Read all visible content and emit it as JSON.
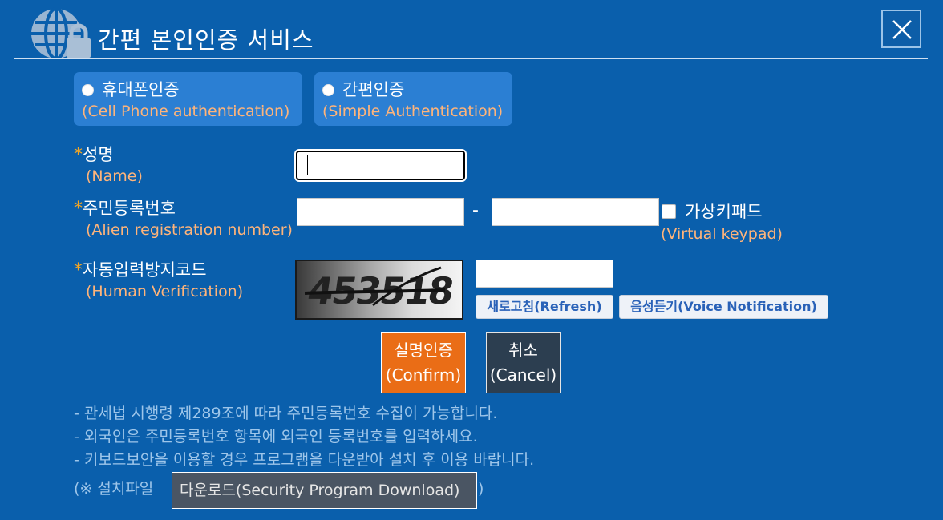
{
  "header": {
    "title": "간편 본인인증 서비스",
    "logo_icon": "globe-lock-icon",
    "close_icon": "close-icon"
  },
  "auth_options": [
    {
      "label": "휴대폰인증",
      "sub": "(Cell Phone authentication)",
      "selected": false
    },
    {
      "label": "간편인증",
      "sub": "(Simple Authentication)",
      "selected": false
    }
  ],
  "form": {
    "required_mark": "*",
    "name": {
      "label": "성명",
      "sub": "(Name)",
      "value": ""
    },
    "registration": {
      "label": "주민등록번호",
      "sub": "(Alien registration number)",
      "part1": "",
      "separator": "-",
      "part2": "",
      "virtual_keypad_label": "가상키패드",
      "virtual_keypad_sub": "(Virtual keypad)",
      "virtual_keypad_checked": false
    },
    "captcha": {
      "label": "자동입력방지코드",
      "sub": "(Human Verification)",
      "image_text": "453518",
      "value": "",
      "refresh_label": "새로고침(Refresh)",
      "voice_label": "음성듣기(Voice Notification)"
    }
  },
  "actions": {
    "confirm_label": "실명인증",
    "confirm_sub": "(Confirm)",
    "cancel_label": "취소",
    "cancel_sub": "(Cancel)"
  },
  "notes": {
    "line1": "- 관세법 시행령 제289조에 따라 주민등록번호 수집이 가능합니다.",
    "line2": "- 외국인은 주민등록번호 항목에 외국인 등록번호를 입력하세요.",
    "line3": "- 키보드보안을 이용할 경우 프로그램을 다운받아 설치 후 이용 바랍니다.",
    "install_prefix": "(※ 설치파일",
    "download_label": "다운로드(Security Program Download)",
    "install_suffix": ")"
  },
  "colors": {
    "background": "#0a5fac",
    "card": "#2b7fd3",
    "accent_orange": "#ea6d16",
    "label_orange": "#ffb47a",
    "cancel": "#2c3e50"
  }
}
